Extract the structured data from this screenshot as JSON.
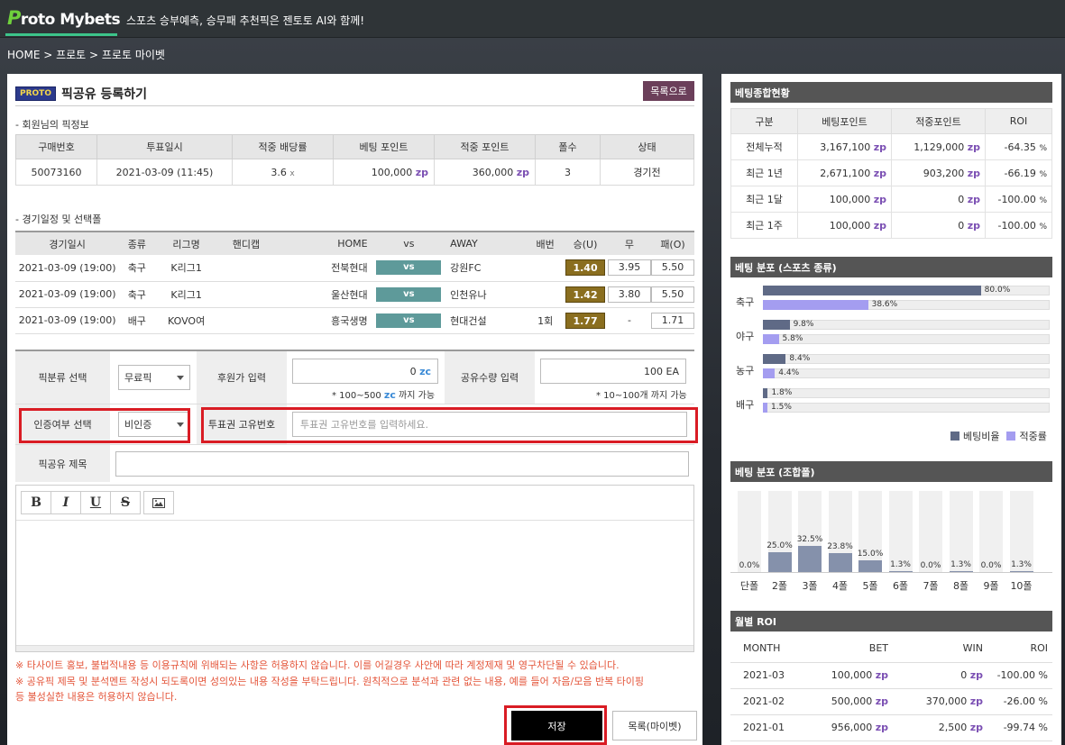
{
  "header": {
    "logo_p": "P",
    "logo_rest": "roto Mybets",
    "tagline": "스포츠 승부예측, 승무패 추천픽은 젠토토 AI와 함께!"
  },
  "breadcrumb": "HOME > 프로토 > 프로토 마이벳",
  "page": {
    "badge": "PROTO",
    "title": "픽공유 등록하기",
    "list_button": "목록으로"
  },
  "purchase": {
    "section_title": "- 회원님의 픽정보",
    "headers": [
      "구매번호",
      "투표일시",
      "적중 배당률",
      "베팅 포인트",
      "적중 포인트",
      "폴수",
      "상태"
    ],
    "row": {
      "id": "50073160",
      "date": "2021-03-09 (11:45)",
      "odds": "3.6",
      "odds_unit": "x",
      "bet": "100,000",
      "win": "360,000",
      "folds": "3",
      "status": "경기전"
    }
  },
  "unit_zp": "zp",
  "unit_zc": "zc",
  "games": {
    "section_title": "- 경기일정 및 선택폴",
    "headers": [
      "경기일시",
      "종류",
      "리그명",
      "핸디캡",
      "HOME",
      "vs",
      "AWAY",
      "배번",
      "승(U)",
      "무",
      "패(O)"
    ],
    "vs_label": "vs",
    "rows": [
      {
        "date": "2021-03-09 (19:00)",
        "sport": "축구",
        "league": "K리그1",
        "handicap": "",
        "home": "전북현대",
        "away": "강원FC",
        "no": "",
        "win": "1.40",
        "draw": "3.95",
        "lose": "5.50"
      },
      {
        "date": "2021-03-09 (19:00)",
        "sport": "축구",
        "league": "K리그1",
        "handicap": "",
        "home": "울산현대",
        "away": "인천유나",
        "no": "",
        "win": "1.42",
        "draw": "3.80",
        "lose": "5.50"
      },
      {
        "date": "2021-03-09 (19:00)",
        "sport": "배구",
        "league": "KOVO여",
        "handicap": "",
        "home": "흥국생명",
        "away": "현대건설",
        "no": "1회",
        "win": "1.77",
        "draw": "-",
        "lose": "1.71"
      }
    ]
  },
  "form": {
    "pick_type_label": "픽분류 선택",
    "pick_type_value": "무료픽",
    "sponsor_label": "후원가 입력",
    "sponsor_value": "0",
    "sponsor_hint_a": "* 100~500",
    "sponsor_hint_b": "까지 가능",
    "share_label": "공유수량 입력",
    "share_value": "100 EA",
    "share_hint": "* 10~100개 까지 가능",
    "auth_label": "인증여부 선택",
    "auth_value": "비인증",
    "ticket_label": "투표권 고유번호",
    "ticket_placeholder": "투표권 고유번호를 입력하세요.",
    "subject_label": "픽공유 제목",
    "subject_value": ""
  },
  "editor": {
    "bold": "B",
    "italic": "I",
    "underline": "U",
    "strike": "S"
  },
  "notice": [
    "※ 타사이트 홍보, 불법적내용 등 이용규칙에 위배되는 사항은 허용하지 않습니다. 이를 어길경우 사안에 따라 계정제재 및 영구차단될 수 있습니다.",
    "※ 공유픽 제목 및 분석멘트 작성시 되도록이면 성의있는 내용 작성을 부탁드립니다. 원칙적으로 분석과 관련 없는 내용, 예를 들어 자음/모음 반복 타이핑",
    "등 불성실한 내용은 허용하지 않습니다."
  ],
  "buttons": {
    "save": "저장",
    "my_list": "목록(마이벳)"
  },
  "summary": {
    "title": "베팅종합현황",
    "headers": [
      "구분",
      "베팅포인트",
      "적중포인트",
      "ROI"
    ],
    "rows": [
      {
        "label": "전체누적",
        "bet": "3,167,100",
        "win": "1,129,000",
        "roi": "-64.35",
        "pct": "%"
      },
      {
        "label": "최근 1년",
        "bet": "2,671,100",
        "win": "903,200",
        "roi": "-66.19",
        "pct": "%"
      },
      {
        "label": "최근 1달",
        "bet": "100,000",
        "win": "0",
        "roi": "-100.00",
        "pct": "%"
      },
      {
        "label": "최근 1주",
        "bet": "100,000",
        "win": "0",
        "roi": "-100.00",
        "pct": "%"
      }
    ]
  },
  "sports_dist": {
    "title": "베팅 분포 (스포츠 종류)",
    "legend_bet": "베팅비율",
    "legend_hit": "적중률",
    "colors": {
      "bet": "#5f6a86",
      "hit": "#a49df0"
    },
    "rows": [
      {
        "label": "축구",
        "bet": 80.0,
        "bet_text": "80.0%",
        "hit": 38.6,
        "hit_text": "38.6%"
      },
      {
        "label": "야구",
        "bet": 9.8,
        "bet_text": "9.8%",
        "hit": 5.8,
        "hit_text": "5.8%"
      },
      {
        "label": "농구",
        "bet": 8.4,
        "bet_text": "8.4%",
        "hit": 4.4,
        "hit_text": "4.4%"
      },
      {
        "label": "배구",
        "bet": 1.8,
        "bet_text": "1.8%",
        "hit": 1.5,
        "hit_text": "1.5%"
      }
    ]
  },
  "chart_data": {
    "type": "bar",
    "title": "베팅 분포 (조합폴)",
    "categories": [
      "단폴",
      "2폴",
      "3폴",
      "4폴",
      "5폴",
      "6폴",
      "7폴",
      "8폴",
      "9폴",
      "10폴"
    ],
    "values": [
      0.0,
      25.0,
      32.5,
      23.8,
      15.0,
      1.3,
      0.0,
      1.3,
      0.0,
      1.3
    ],
    "labels": [
      "0.0%",
      "25.0%",
      "32.5%",
      "23.8%",
      "15.0%",
      "1.3%",
      "0.0%",
      "1.3%",
      "0.0%",
      "1.3%"
    ],
    "ylim": [
      0,
      100
    ]
  },
  "monthly": {
    "title": "월별 ROI",
    "headers": [
      "MONTH",
      "BET",
      "WIN",
      "ROI"
    ],
    "rows": [
      {
        "month": "2021-03",
        "bet": "100,000",
        "win": "0",
        "roi": "-100.00 %"
      },
      {
        "month": "2021-02",
        "bet": "500,000",
        "win": "370,000",
        "roi": "-26.00 %"
      },
      {
        "month": "2021-01",
        "bet": "956,000",
        "win": "2,500",
        "roi": "-99.74 %"
      }
    ]
  }
}
